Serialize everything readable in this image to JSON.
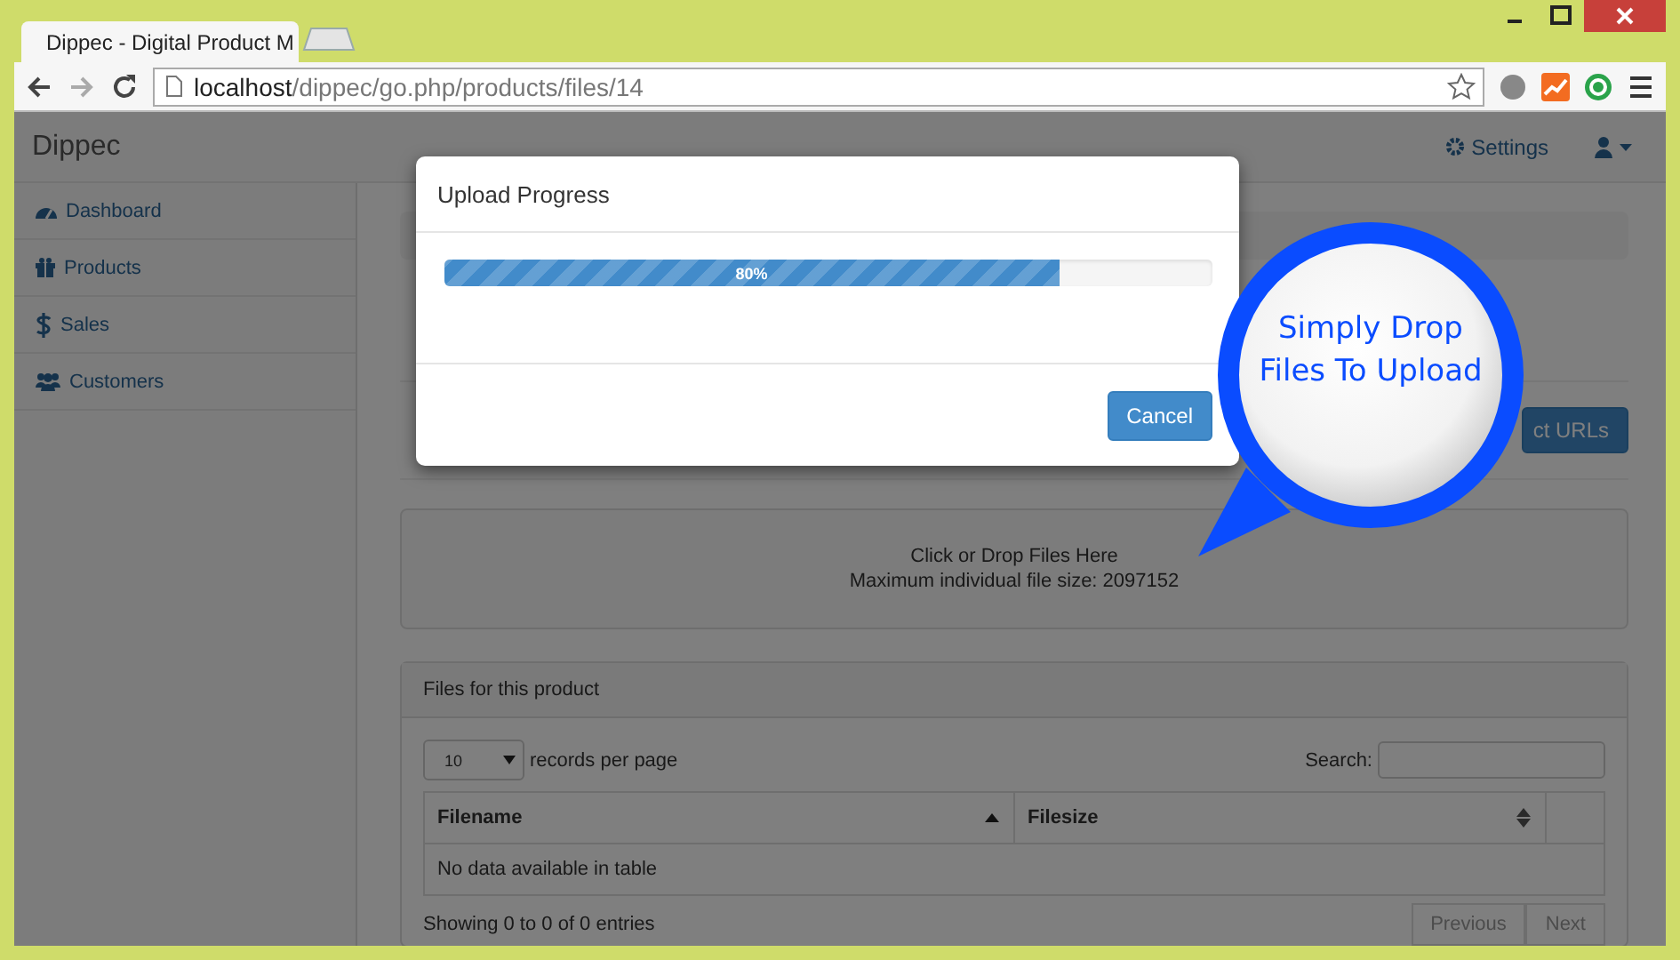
{
  "browser": {
    "tab_title": "Dippec - Digital Product M",
    "url_host": "localhost",
    "url_path": "/dippec/go.php/products/files/14"
  },
  "navbar": {
    "brand": "Dippec",
    "settings": "Settings"
  },
  "sidebar": {
    "items": [
      {
        "label": "Dashboard",
        "kind": "dashboard"
      },
      {
        "label": "Products",
        "kind": "gift"
      },
      {
        "label": "Sales",
        "kind": "dollar"
      },
      {
        "label": "Customers",
        "kind": "users"
      }
    ]
  },
  "page": {
    "action_button": "ct URLs"
  },
  "dropzone": {
    "title": "Click or Drop Files Here",
    "note": "Maximum individual file size: 2097152"
  },
  "files_panel": {
    "title": "Files for this product",
    "page_size": "10",
    "page_size_label": "records per page",
    "search_label": "Search:",
    "columns": [
      {
        "label": "Filename",
        "sorted": true
      },
      {
        "label": "Filesize",
        "sorted": false
      }
    ],
    "empty_message": "No data available in table",
    "info": "Showing 0 to 0 of 0 entries",
    "pager": [
      {
        "label": "Previous",
        "disabled": true
      },
      {
        "label": "Next",
        "disabled": true
      }
    ]
  },
  "modal": {
    "title": "Upload Progress",
    "progress": {
      "level": 0.8,
      "label": "80%"
    },
    "cancel": "Cancel"
  },
  "callout": {
    "lines": [
      "Simply Drop",
      "Files To Upload"
    ]
  }
}
